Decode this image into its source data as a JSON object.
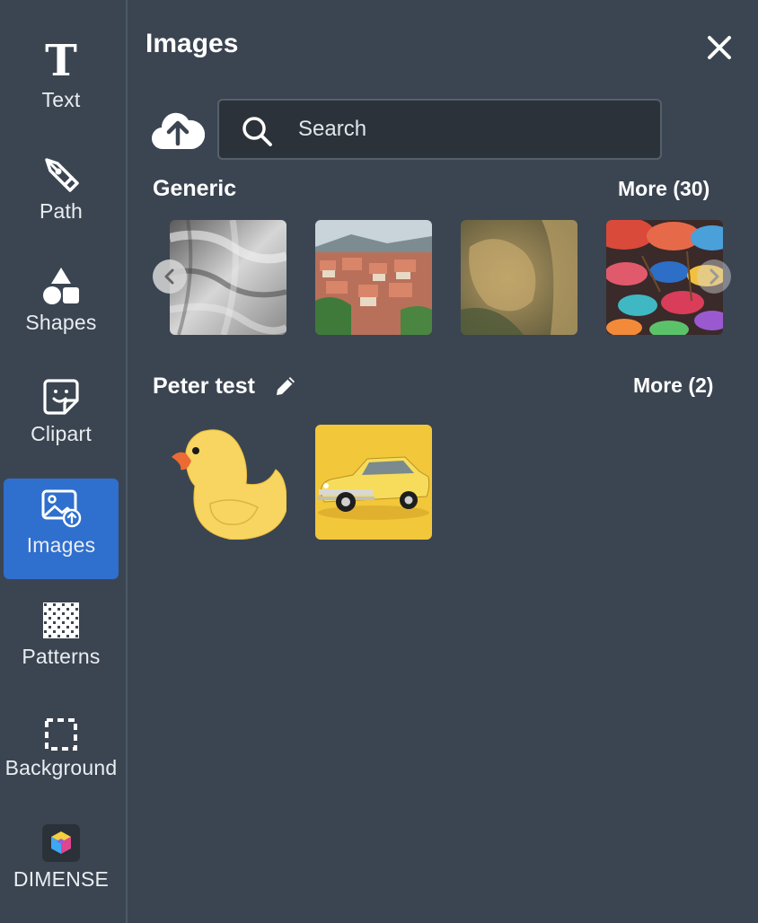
{
  "sidebar": {
    "items": [
      {
        "label": "Text",
        "icon": "text-icon",
        "active": false
      },
      {
        "label": "Path",
        "icon": "pen-tool-icon",
        "active": false
      },
      {
        "label": "Shapes",
        "icon": "shapes-icon",
        "active": false
      },
      {
        "label": "Clipart",
        "icon": "sticker-icon",
        "active": false
      },
      {
        "label": "Images",
        "icon": "image-upload-icon",
        "active": true
      },
      {
        "label": "Patterns",
        "icon": "checkerboard-icon",
        "active": false
      },
      {
        "label": "Background",
        "icon": "dashed-square-icon",
        "active": false
      },
      {
        "label": "DIMENSE",
        "icon": "dimense-cube-icon",
        "active": false
      }
    ],
    "active_color": "#2f6fce"
  },
  "panel": {
    "title": "Images",
    "close_icon": "close-icon",
    "upload_icon": "cloud-upload-icon",
    "search": {
      "placeholder": "Search",
      "value": ""
    },
    "sections": [
      {
        "title": "Generic",
        "more_label": "More (30)",
        "images": [
          "gray-texture",
          "hillside-town",
          "sandstone-rock",
          "colorful-umbrellas"
        ],
        "nav": [
          "chevron-left-icon",
          "chevron-right-icon"
        ]
      },
      {
        "title": "Peter test",
        "edit_icon": "pencil-icon",
        "more_label": "More (2)",
        "images": [
          "yellow-rubber-duck",
          "yellow-classic-car"
        ]
      }
    ]
  },
  "colors": {
    "background": "#3b4551",
    "search_bg": "#2b3239"
  }
}
